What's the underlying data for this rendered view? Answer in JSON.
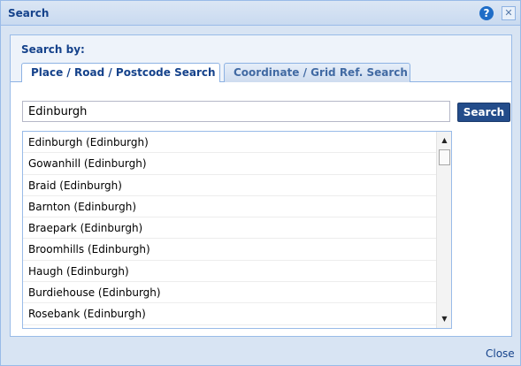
{
  "window": {
    "title": "Search",
    "help_icon": "question-mark-icon",
    "help_glyph": "?",
    "close_icon": "close-icon",
    "close_glyph": "✕"
  },
  "search_by_label": "Search by:",
  "tabs": [
    {
      "label": "Place / Road / Postcode Search",
      "active": true
    },
    {
      "label": "Coordinate / Grid Ref. Search",
      "active": false
    }
  ],
  "search": {
    "value": "Edinburgh",
    "button_label": "Search"
  },
  "results": [
    "Edinburgh (Edinburgh)",
    "Gowanhill (Edinburgh)",
    "Braid (Edinburgh)",
    "Barnton (Edinburgh)",
    "Braepark (Edinburgh)",
    "Broomhills (Edinburgh)",
    "Haugh (Edinburgh)",
    "Burdiehouse (Edinburgh)",
    "Rosebank (Edinburgh)"
  ],
  "scrollbar": {
    "up_glyph": "▲",
    "down_glyph": "▼"
  },
  "footer": {
    "close_label": "Close"
  },
  "colors": {
    "accent": "#15428b",
    "button": "#234c8a",
    "border": "#99bbe8"
  }
}
